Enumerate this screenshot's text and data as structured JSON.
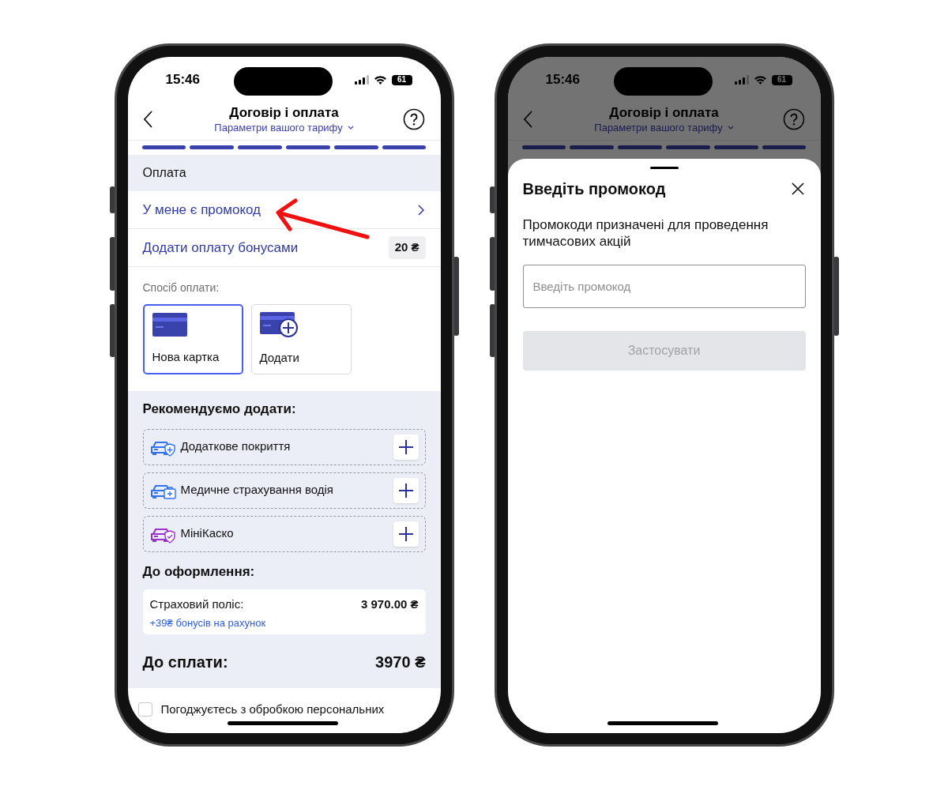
{
  "payment_screen": {
    "status_bar": {
      "time": "15:46",
      "battery": "61"
    },
    "header": {
      "title": "Договір і оплата",
      "subtitle": "Параметри вашого тарифу"
    },
    "steps": [
      {
        "done": true
      },
      {
        "done": true
      },
      {
        "done": true
      },
      {
        "done": true
      },
      {
        "done": true
      },
      {
        "done": true
      }
    ],
    "section_title": "Оплата",
    "rows": [
      {
        "kind": "chevron",
        "label": "У мене є промокод"
      },
      {
        "kind": "badge",
        "label": "Додати оплату бонусами",
        "badge": "20 ₴"
      }
    ],
    "payment_method": {
      "label": "Спосіб оплати:",
      "options": [
        {
          "kind": "card",
          "label": "Нова картка",
          "selected": true
        },
        {
          "kind": "add",
          "label": "Додати",
          "selected": false
        }
      ]
    },
    "recommended": {
      "title": "Рекомендуємо додати:",
      "items": [
        {
          "kind": "shield_plus",
          "label": "Додаткове покриття",
          "color": "#2f73f0"
        },
        {
          "kind": "medical",
          "label": "Медичне страхування водія",
          "color": "#2f73f0"
        },
        {
          "kind": "shield_check",
          "label": "МініКаско",
          "color": "#9b2fc9"
        }
      ]
    },
    "checkout": {
      "title": "До оформлення:",
      "items": [
        {
          "label": "Страховий поліс:",
          "amount": "3 970.00 ₴",
          "bonus": "+39₴ бонусів на рахунок"
        }
      ]
    },
    "total": {
      "label": "До сплати:",
      "amount": "3970 ₴"
    },
    "consent": {
      "label": "Погоджуєтесь з обробкою персональних",
      "checked": false
    }
  },
  "promo_screen": {
    "status_bar": {
      "time": "15:46",
      "battery": "61"
    },
    "header": {
      "title": "Договір і оплата",
      "subtitle": "Параметри вашого тарифу"
    },
    "steps": [
      {
        "done": true
      },
      {
        "done": true
      },
      {
        "done": true
      },
      {
        "done": true
      },
      {
        "done": true
      },
      {
        "done": true
      }
    ],
    "sheet": {
      "title": "Введіть промокод",
      "description": "Промокоди призначені для проведення тимчасових акцій",
      "placeholder": "Введіть промокод",
      "button": {
        "label": "Застосувати",
        "disabled": true
      }
    }
  }
}
